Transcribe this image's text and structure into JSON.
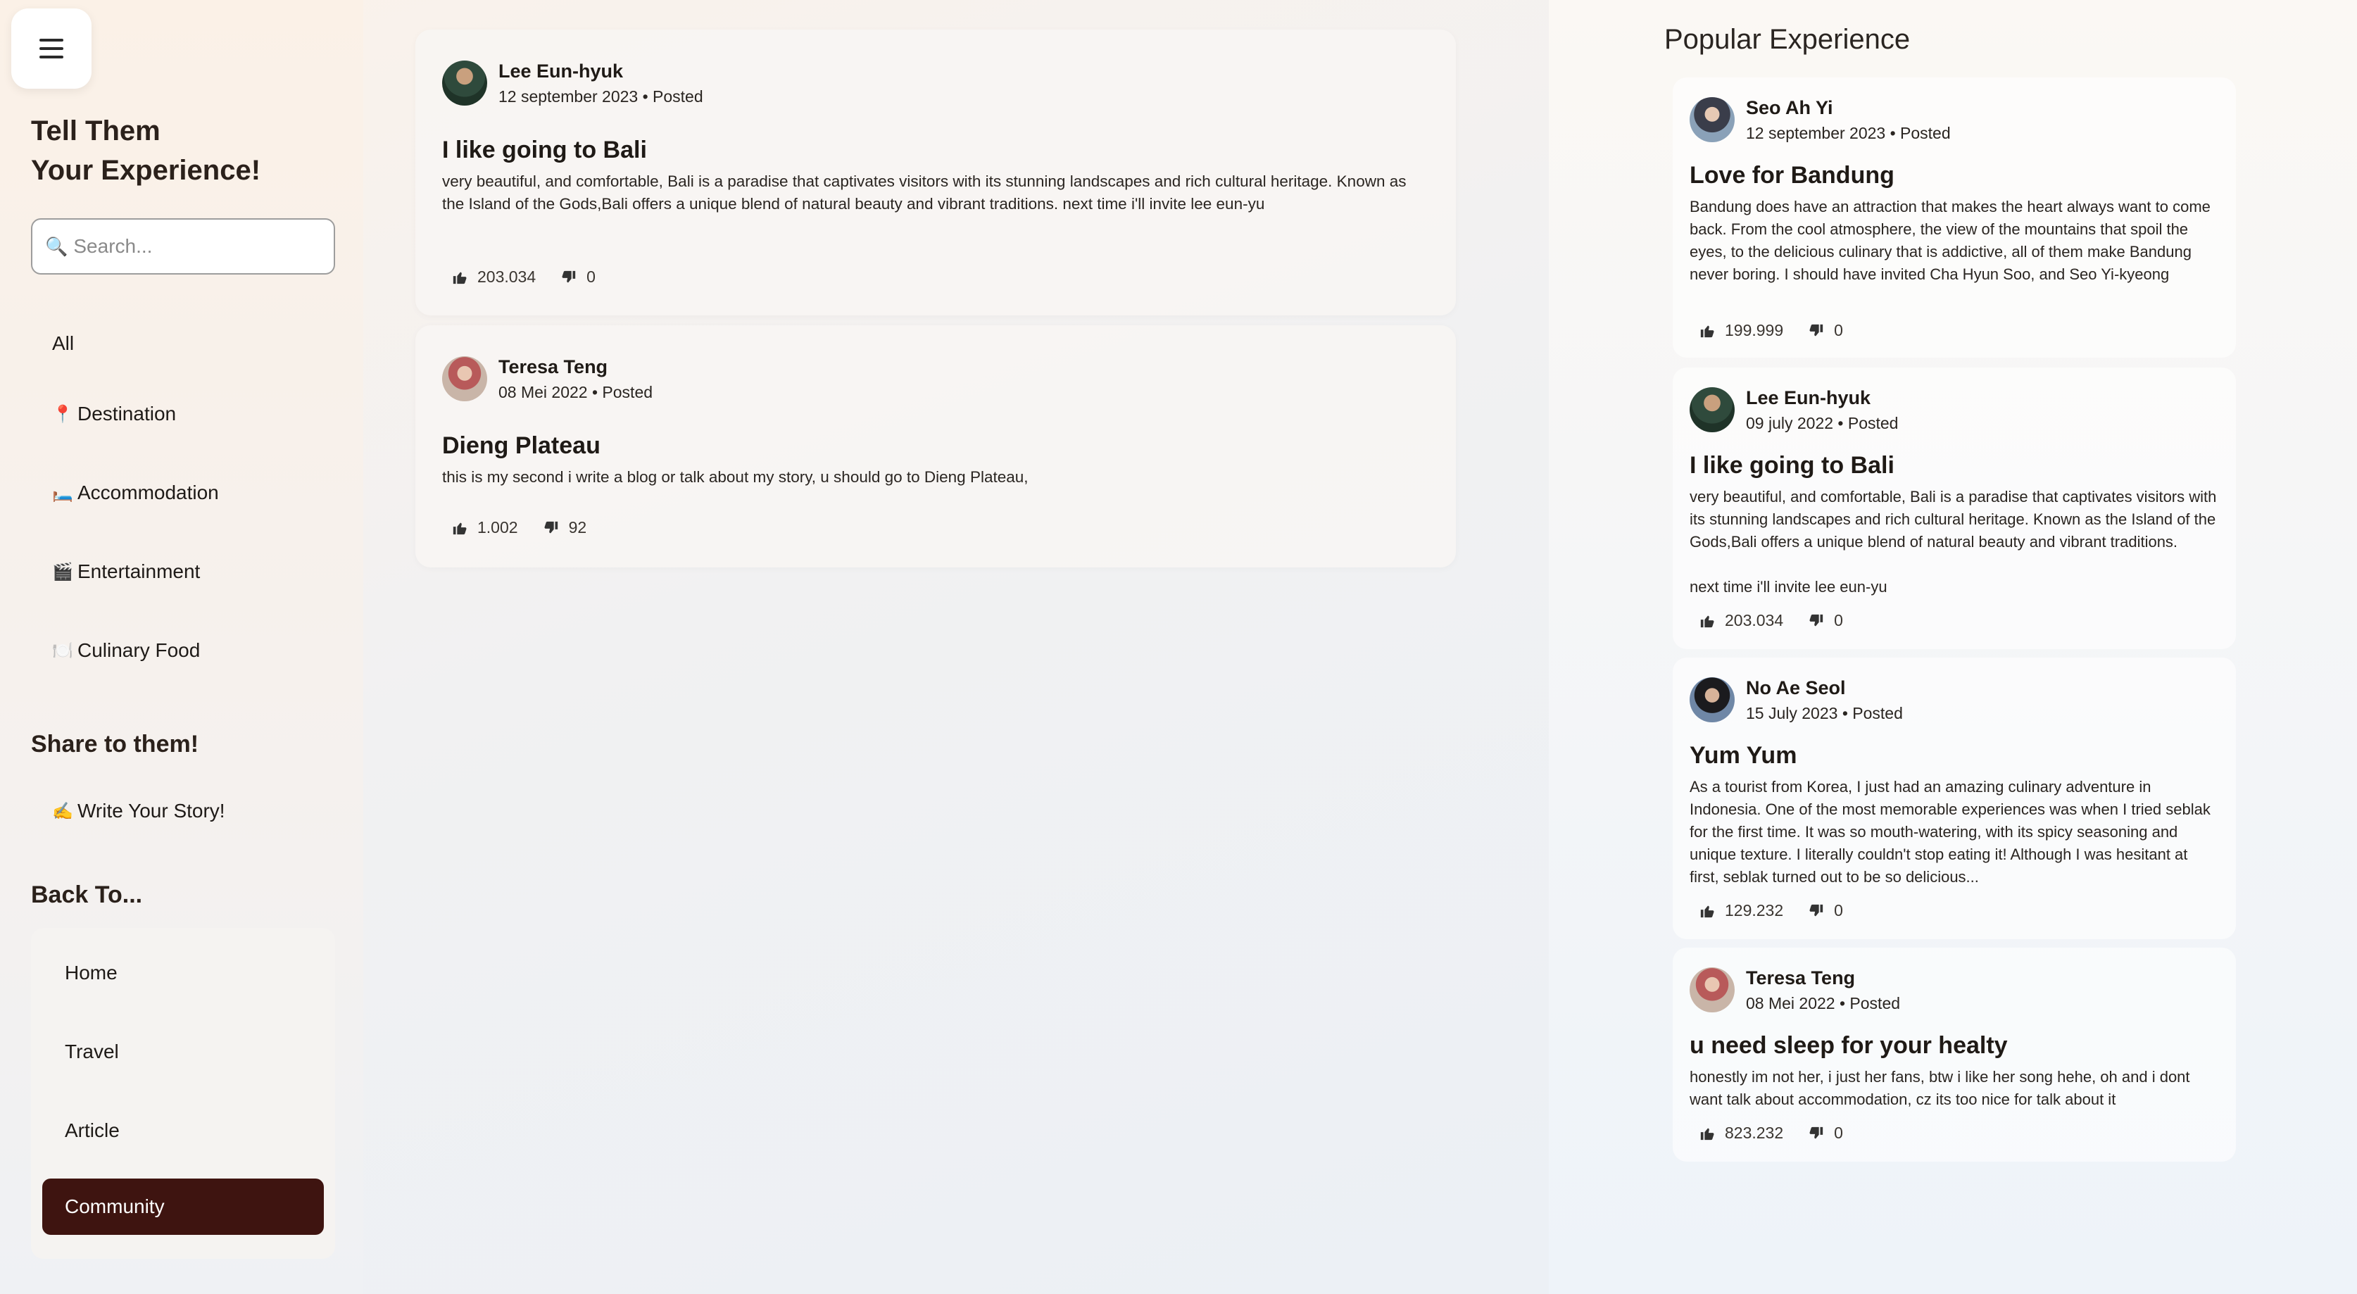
{
  "sidebar": {
    "menu_icon": "hamburger-menu-icon",
    "title_line1": "Tell Them",
    "title_line2": "Your Experience!",
    "search_placeholder": "Search...",
    "categories": [
      {
        "icon": "",
        "label": "All"
      },
      {
        "icon": "📍",
        "label": "Destination"
      },
      {
        "icon": "🛏️",
        "label": "Accommodation"
      },
      {
        "icon": "🎬",
        "label": "Entertainment"
      },
      {
        "icon": "🍽️",
        "label": "Culinary Food"
      }
    ],
    "share_title": "Share to them!",
    "write_icon": "✍️",
    "write_label": "Write Your Story!",
    "back_title": "Back To...",
    "back_items": [
      "Home",
      "Travel",
      "Article",
      "Community"
    ],
    "active_back_item": "Community"
  },
  "feed": [
    {
      "author": "Lee Eun-hyuk",
      "meta": "12 september 2023 • Posted",
      "title": "I like going to Bali",
      "body": "very beautiful, and comfortable, Bali is a paradise that captivates visitors with its stunning landscapes and rich cultural heritage. Known as the Island of the Gods,Bali offers a unique blend of natural beauty and vibrant traditions. next time i'll invite lee eun-yu",
      "likes": "203.034",
      "dislikes": "0"
    },
    {
      "author": "Teresa Teng",
      "meta": "08 Mei 2022 • Posted",
      "title": "Dieng Plateau",
      "body": "this is my second i write a blog or talk about my story, u should go to Dieng Plateau,",
      "likes": "1.002",
      "dislikes": "92"
    }
  ],
  "popular": {
    "title": "Popular Experience",
    "items": [
      {
        "author": "Seo Ah Yi",
        "meta": "12 september 2023 • Posted",
        "title": "Love for Bandung",
        "body": "Bandung does have an attraction that makes the heart always want to come back. From the cool atmosphere, the view of the mountains that spoil the eyes, to the delicious culinary that is addictive, all of them make Bandung never boring. I should have invited Cha Hyun Soo, and Seo Yi-kyeong",
        "likes": "199.999",
        "dislikes": "0"
      },
      {
        "author": "Lee Eun-hyuk",
        "meta": "09 july 2022 • Posted",
        "title": "I like going to Bali",
        "body": "very beautiful, and comfortable, Bali is a paradise that captivates visitors with its stunning landscapes and rich cultural heritage. Known as the Island of the Gods,Bali offers a unique blend of natural beauty and vibrant traditions.",
        "body2": "next time i'll invite lee eun-yu",
        "likes": "203.034",
        "dislikes": "0"
      },
      {
        "author": "No Ae Seol",
        "meta": "15 July 2023 • Posted",
        "title": "Yum Yum",
        "body": "As a tourist from Korea, I just had an amazing culinary adventure in Indonesia. One of the most memorable experiences was when I tried seblak for the first time. It was so mouth-watering, with its spicy seasoning and unique texture. I literally couldn't stop eating it! Although I was hesitant at first, seblak turned out to be so delicious...",
        "likes": "129.232",
        "dislikes": "0"
      },
      {
        "author": "Teresa Teng",
        "meta": "08 Mei 2022 • Posted",
        "title": "u need sleep for your healty",
        "body": "honestly im not her, i just her fans, btw i like her song hehe, oh and i dont want talk about accommodation, cz its too nice for talk about it",
        "likes": "823.232",
        "dislikes": "0"
      }
    ]
  },
  "icons": {
    "like": "thumbs-up-icon",
    "dislike": "thumbs-down-icon",
    "search": "magnifier-icon"
  }
}
